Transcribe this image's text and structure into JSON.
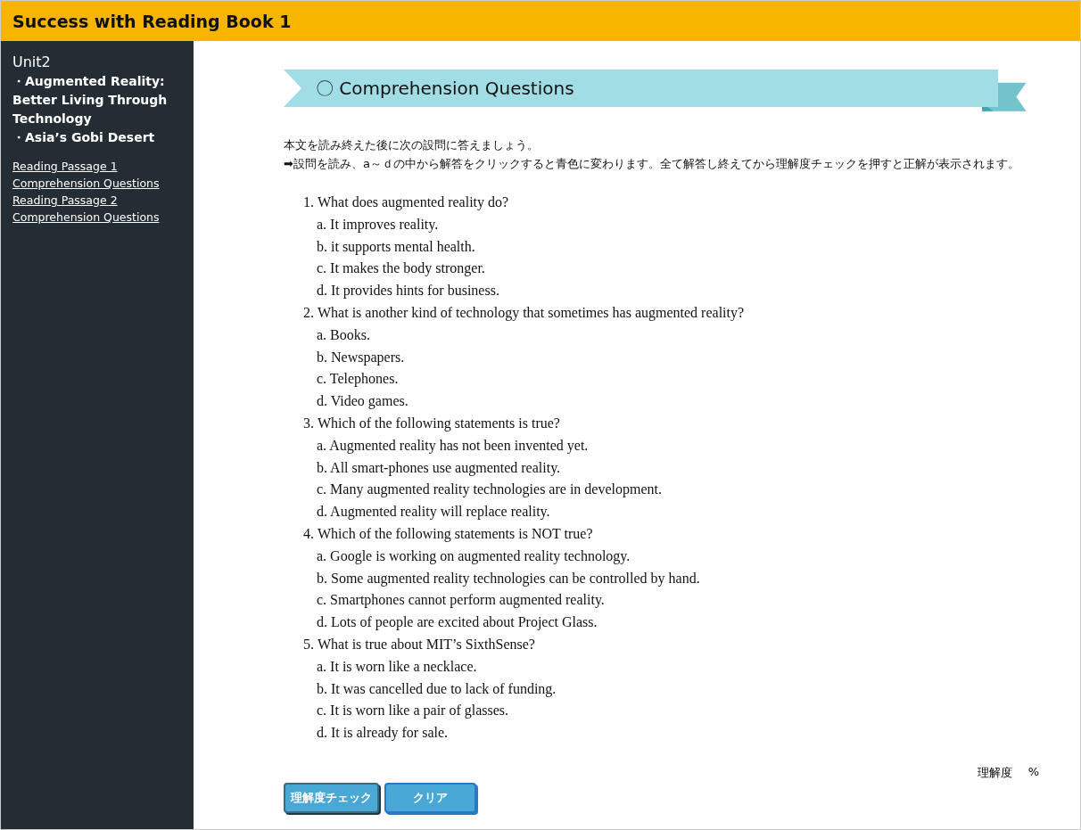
{
  "header": {
    "title": "Success with Reading Book 1"
  },
  "sidebar": {
    "unit": "Unit2",
    "topics": [
      "・Augmented Reality: Better Living Through Technology",
      "・Asia’s Gobi Desert"
    ],
    "links": [
      "Reading Passage 1",
      "Comprehension Questions",
      "Reading Passage 2",
      "Comprehension Questions"
    ]
  },
  "banner": {
    "title": "〇 Comprehension Questions"
  },
  "instructions": [
    "本文を読み終えた後に次の設問に答えましょう。",
    "➡設問を読み、a～ｄの中から解答をクリックすると青色に変わります。全て解答し終えてから理解度チェックを押すと正解が表示されます。"
  ],
  "questions": [
    {
      "number": "1.",
      "text": "What does augmented reality do?",
      "options": [
        {
          "text": "a. It improves reality.",
          "selected": false
        },
        {
          "text": "b. it supports mental health.",
          "selected": false
        },
        {
          "text": "c. It makes the body stronger.",
          "selected": false
        },
        {
          "text": "d. It provides hints for business.",
          "selected": false
        }
      ]
    },
    {
      "number": "2.",
      "text": "What is another kind of technology that sometimes has augmented reality?",
      "options": [
        {
          "text": "a. Books.",
          "selected": false
        },
        {
          "text": "b. Newspapers.",
          "selected": false
        },
        {
          "text": "c. Telephones.",
          "selected": false
        },
        {
          "text": "d. Video games.",
          "selected": false
        }
      ]
    },
    {
      "number": "3.",
      "text": "Which of the following statements is true?",
      "options": [
        {
          "text": "a. Augmented reality has not been invented yet.",
          "selected": false
        },
        {
          "text": "b. All smart-phones use augmented reality.",
          "selected": false
        },
        {
          "text": "c. Many augmented reality technologies are in development.",
          "selected": false
        },
        {
          "text": "d. Augmented reality will replace reality.",
          "selected": false
        }
      ]
    },
    {
      "number": "4.",
      "text": "Which of the following statements is NOT true?",
      "options": [
        {
          "text": "a. Google is working on augmented reality technology.",
          "selected": false
        },
        {
          "text": "b. Some augmented reality technologies can be controlled by hand.",
          "selected": false
        },
        {
          "text": "c. Smartphones cannot perform augmented reality.",
          "selected": false
        },
        {
          "text": "d. Lots of people are excited about Project Glass.",
          "selected": false
        }
      ]
    },
    {
      "number": "5.",
      "text": "What is true about MIT’s SixthSense?",
      "options": [
        {
          "text": "a. It is worn like a necklace.",
          "selected": false
        },
        {
          "text": "b. It was cancelled due to lack of funding.",
          "selected": false
        },
        {
          "text": "c. It is worn like a pair of glasses.",
          "selected": false
        },
        {
          "text": "d. It is already for sale.",
          "selected": false
        }
      ]
    }
  ],
  "score": {
    "label": "理解度",
    "unit": "%"
  },
  "buttons": [
    "理解度チェック",
    "クリア"
  ]
}
